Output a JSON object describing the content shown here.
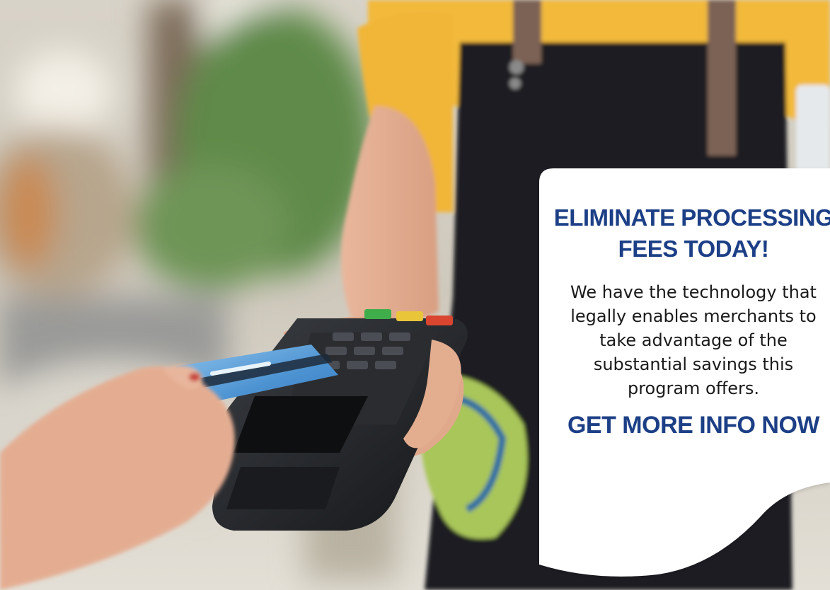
{
  "hero": {
    "photo_description_icon": "card-payment-photo"
  },
  "promo": {
    "headline_line1": "ELIMINATE PROCESSING",
    "headline_line2": "FEES TODAY!",
    "body_line1": "We have the technology that",
    "body_line2": "legally enables merchants to",
    "body_line3": "take advantage of the",
    "body_line4": "substantial savings this",
    "body_line5": "program offers.",
    "cta_label": "GET MORE INFO NOW"
  },
  "colors": {
    "headline": "#1c3f86",
    "cta": "#1c3f86",
    "card_background": "#ffffff"
  }
}
